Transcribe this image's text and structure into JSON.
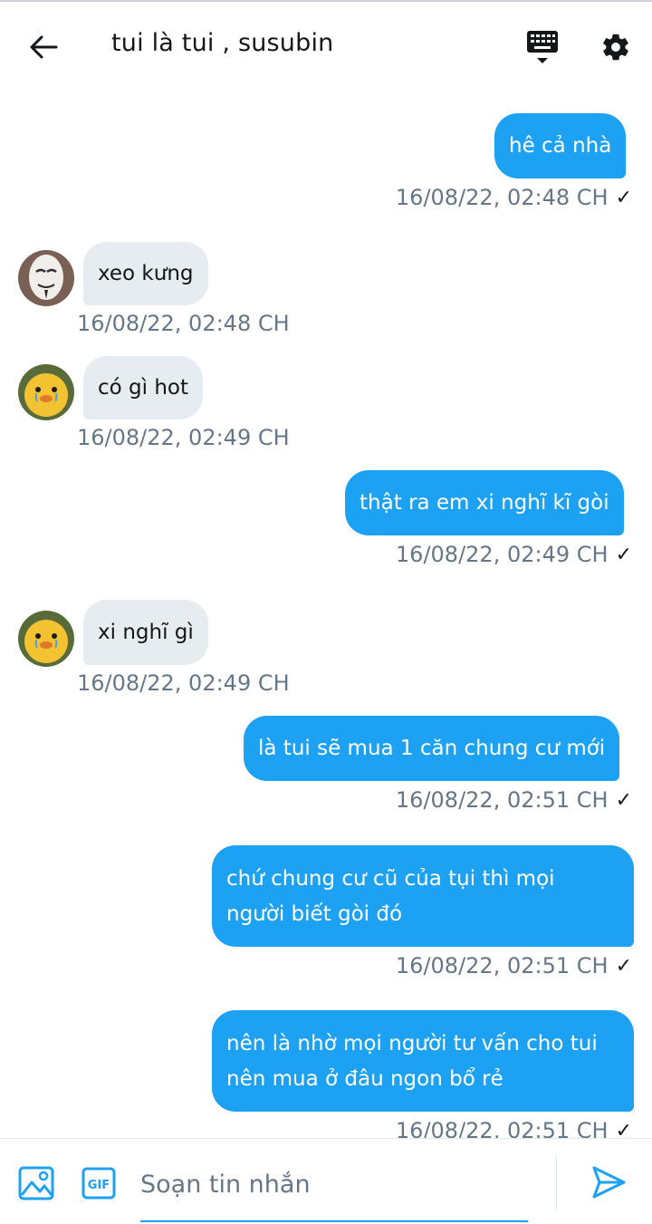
{
  "header": {
    "title": "tui là tui , susubin",
    "back_icon": "arrow-left-icon",
    "keyboard_icon": "keyboard-icon",
    "settings_icon": "gear-icon"
  },
  "messages": [
    {
      "direction": "out",
      "text": "hê cả nhà",
      "time": "16/08/22,  02:48 CH",
      "read": "✓"
    },
    {
      "direction": "in",
      "text": "xeo kưng",
      "time": "16/08/22,  02:48 CH",
      "avatar": "mask-avatar"
    },
    {
      "direction": "in",
      "text": "có gì hot",
      "time": "16/08/22,  02:49 CH",
      "avatar": "duck-avatar"
    },
    {
      "direction": "out",
      "text": "thật ra em xi nghĩ kĩ gòi",
      "time": "16/08/22,  02:49 CH",
      "read": "✓"
    },
    {
      "direction": "in",
      "text": "xi nghĩ gì",
      "time": "16/08/22,  02:49 CH",
      "avatar": "duck-avatar"
    },
    {
      "direction": "out",
      "text": "là tui sẽ mua 1 căn chung cư mới",
      "time": "16/08/22,  02:51 CH",
      "read": "✓"
    },
    {
      "direction": "out",
      "text": "chứ chung cư cũ của tụi thì mọi người biết gòi đó",
      "time": "16/08/22,  02:51 CH",
      "read": "✓"
    },
    {
      "direction": "out",
      "text": "nên là nhờ mọi người tư vấn cho tui nên mua ở đâu ngon bổ rẻ",
      "time": "16/08/22,  02:51 CH",
      "read": "✓"
    }
  ],
  "composer": {
    "placeholder": "Soạn tin nhắn",
    "image_icon": "image-icon",
    "gif_label": "GIF",
    "send_icon": "send-icon"
  },
  "colors": {
    "accent": "#1da1f2",
    "incoming_bubble": "#e6ecf0",
    "timestamp": "#657786"
  }
}
